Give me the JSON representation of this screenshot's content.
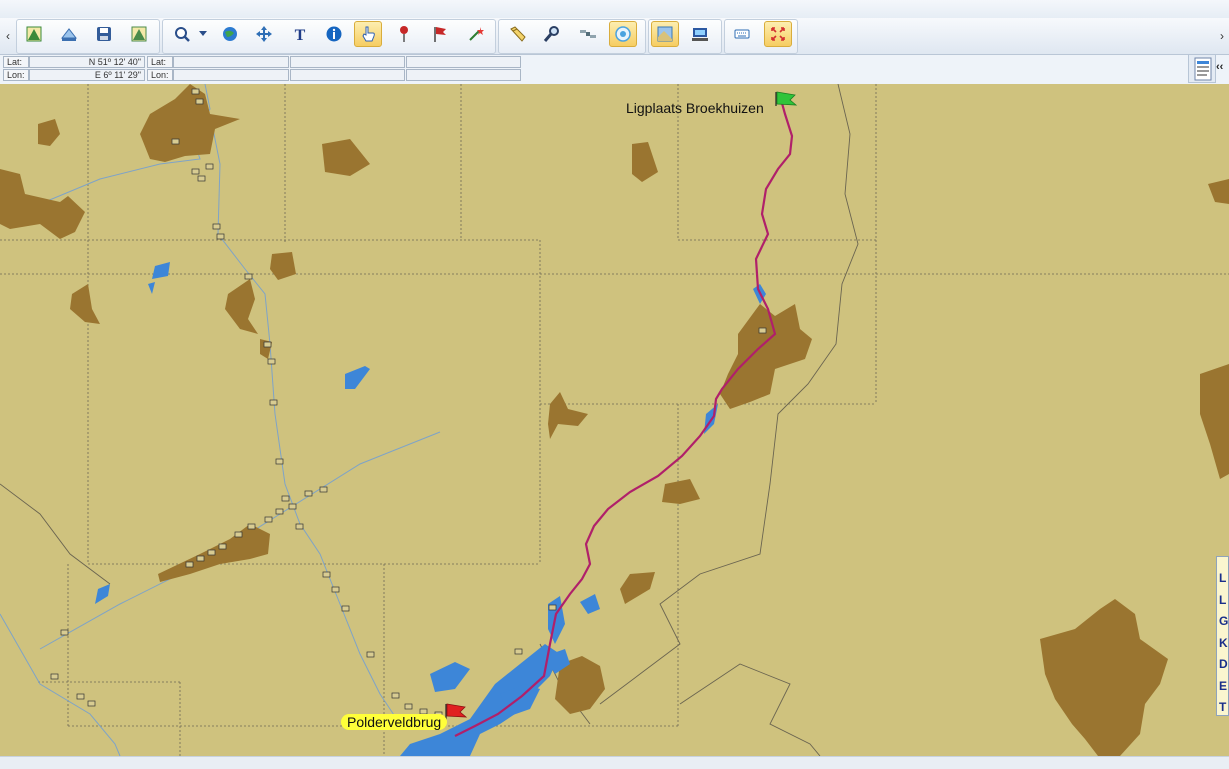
{
  "toolbar": {
    "scroll_left": "‹",
    "scroll_right": "›",
    "buttons": [
      {
        "name": "open-chart-icon",
        "color": "#3a8a3a"
      },
      {
        "name": "chart-catalog-icon",
        "color": "#3b6fb0"
      },
      {
        "name": "save-icon",
        "color": "#335c99"
      },
      {
        "name": "chart-properties-icon",
        "color": "#4a8b4a"
      },
      {
        "name": "zoom-icon",
        "color": "#2a4e8a"
      },
      {
        "name": "globe-icon",
        "color": "#2c7bd1"
      },
      {
        "name": "pan-icon",
        "color": "#2f6fb6"
      },
      {
        "name": "text-icon",
        "color": "#1f3c88"
      },
      {
        "name": "info-icon",
        "color": "#1565c0"
      },
      {
        "name": "pointer-hand-icon",
        "color": "#2d5fb0"
      },
      {
        "name": "pushpin-icon",
        "color": "#c62828"
      },
      {
        "name": "flag-icon",
        "color": "#c62828"
      },
      {
        "name": "sparkle-route-icon",
        "color": "#2e7d32"
      },
      {
        "name": "measure-tool-icon",
        "color": "#8a6d1c"
      },
      {
        "name": "search-magnifier-icon",
        "color": "#2b3f63"
      },
      {
        "name": "satellite-icon",
        "color": "#546e7a"
      },
      {
        "name": "compass-icon",
        "color": "#4aa3df"
      },
      {
        "name": "map-view-icon",
        "color": "#3b78b4"
      },
      {
        "name": "ship-display-icon",
        "color": "#2b58a2"
      },
      {
        "name": "keyboard-icon",
        "color": "#2e6db4"
      },
      {
        "name": "fullscreen-icon",
        "color": "#d32f2f"
      }
    ]
  },
  "coords": {
    "lat_label": "Lat:",
    "lat_value": "N 51º 12' 40\"",
    "lon_label": "Lon:",
    "lon_value": "E 6º 11' 29\"",
    "lat2_label": "Lat:",
    "lon2_label": "Lon:"
  },
  "map": {
    "start_label": "Ligplaats Broekhuizen",
    "end_label": "Polderveldbrug",
    "colors": {
      "land": "#cfc27e",
      "builtup": "#9a7530",
      "water": "#3d86d8",
      "route": "#b0206a",
      "grid": "#6e6a55"
    }
  },
  "side_panel": {
    "collapse_label": "‹‹",
    "legend_items": [
      "L",
      "L",
      "G",
      "K",
      "D",
      "E",
      "T"
    ]
  }
}
